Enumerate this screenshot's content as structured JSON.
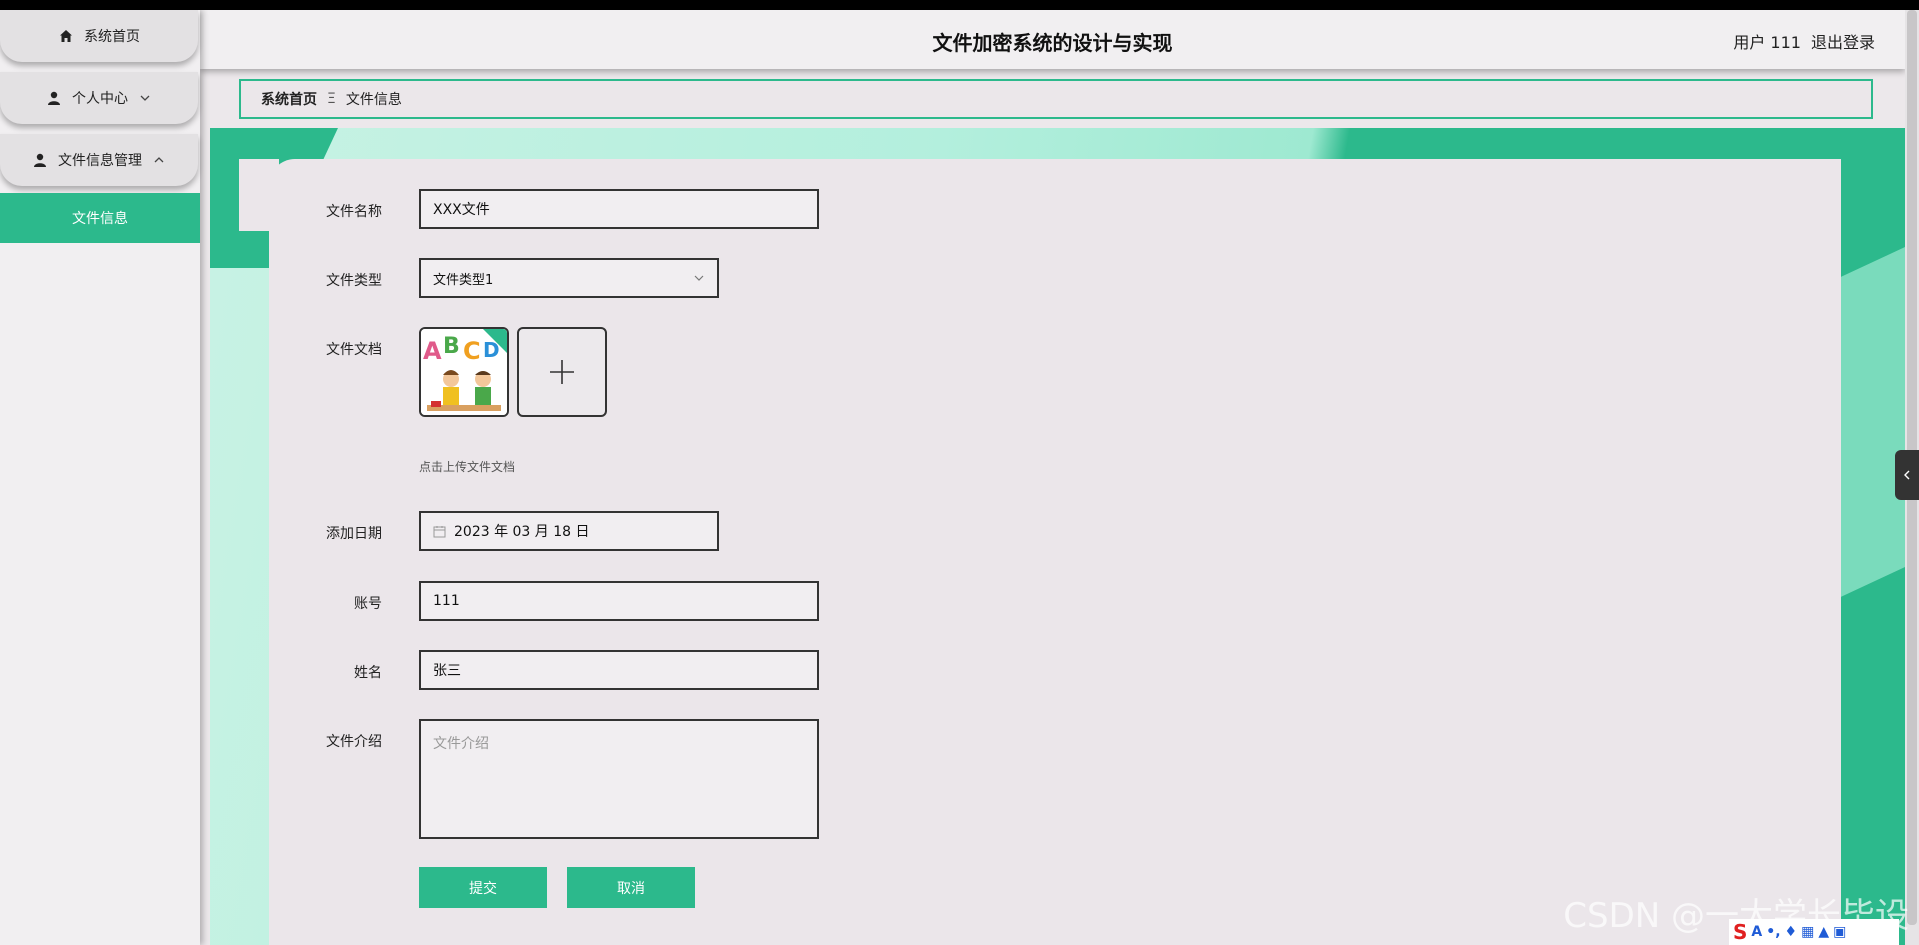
{
  "sidebar": {
    "items": [
      {
        "label": "系统首页",
        "icon": "home-icon"
      },
      {
        "label": "个人中心",
        "icon": "user-icon"
      },
      {
        "label": "文件信息管理",
        "icon": "user-icon"
      }
    ],
    "active_sub": "文件信息"
  },
  "header": {
    "title": "文件加密系统的设计与实现",
    "user": "用户 111",
    "logout": "退出登录"
  },
  "breadcrumb": {
    "home": "系统首页",
    "sep": "Ξ",
    "current": "文件信息"
  },
  "form": {
    "file_name": {
      "label": "文件名称",
      "value": "XXX文件"
    },
    "file_type": {
      "label": "文件类型",
      "value": "文件类型1"
    },
    "file_doc": {
      "label": "文件文档",
      "hint": "点击上传文件文档"
    },
    "add_date": {
      "label": "添加日期",
      "value": "2023 年 03 月 18 日"
    },
    "account": {
      "label": "账号",
      "value": "111"
    },
    "name": {
      "label": "姓名",
      "value": "张三"
    },
    "intro": {
      "label": "文件介绍",
      "placeholder": "文件介绍"
    },
    "submit": "提交",
    "cancel": "取消"
  },
  "watermark": "CSDN @一大学长毕设",
  "colors": {
    "accent": "#2cb98c",
    "background": "#ece8eb"
  }
}
